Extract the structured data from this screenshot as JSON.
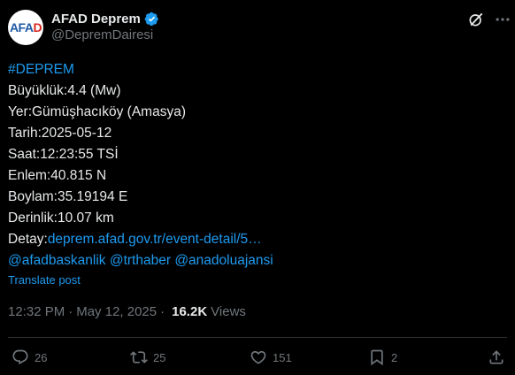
{
  "author": {
    "avatar_text_left": "AFA",
    "avatar_text_right": "D",
    "display_name": "AFAD Deprem",
    "handle": "@DepremDairesi",
    "verified_icon": "verified-badge-icon"
  },
  "tweet": {
    "lines": [
      {
        "text": "#DEPREM"
      },
      {
        "text": "Büyüklük:4.4 (Mw)"
      },
      {
        "text": "Yer:Gümüşhacıköy (Amasya)"
      },
      {
        "text": "Tarih:2025-05-12"
      },
      {
        "text": "Saat:12:23:55 TSİ"
      },
      {
        "text": "Enlem:40.815 N"
      },
      {
        "text": "Boylam:35.19194 E"
      },
      {
        "text": "Derinlik:10.07 km"
      }
    ],
    "detay_label": "Detay:",
    "detay_link": "deprem.afad.gov.tr/event-detail/5…",
    "mentions": [
      "@afadbaskanlik",
      "@trthaber",
      "@anadoluajansi"
    ],
    "translate": "Translate post"
  },
  "meta": {
    "time": "12:32 PM",
    "date": "May 12, 2025",
    "views_count": "16.2K",
    "views_label": "Views"
  },
  "actions": {
    "replies": "26",
    "reposts": "25",
    "likes": "151",
    "bookmarks": "2"
  },
  "colors": {
    "background": "#000000",
    "text": "#e7e9ea",
    "muted": "#71767b",
    "link": "#1d9bf0"
  }
}
